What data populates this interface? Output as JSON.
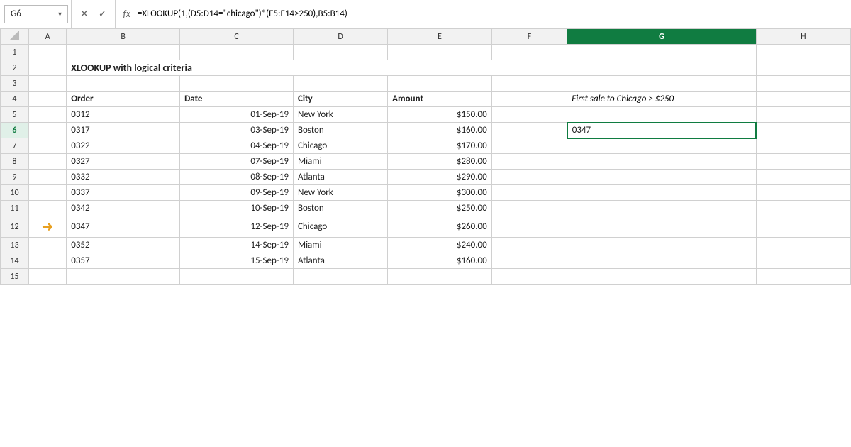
{
  "formulaBar": {
    "cellRef": "G6",
    "dropdownArrow": "▾",
    "icons": {
      "cancel": "✕",
      "confirm": "✓",
      "fx": "fx"
    },
    "formula": "=XLOOKUP(1,(D5:D14=\"chicago\")*(E5:E14>250),B5:B14)"
  },
  "columnHeaders": [
    "",
    "A",
    "B",
    "C",
    "D",
    "E",
    "F",
    "G",
    "H"
  ],
  "title": "XLOOKUP with logical criteria",
  "tableHeaders": {
    "order": "Order",
    "date": "Date",
    "city": "City",
    "amount": "Amount"
  },
  "rows": [
    {
      "rowNum": "1",
      "a": "",
      "b": "",
      "c": "",
      "d": "",
      "e": "",
      "f": "",
      "g": "",
      "h": ""
    },
    {
      "rowNum": "2",
      "a": "",
      "b": "XLOOKUP with logical criteria",
      "c": "",
      "d": "",
      "e": "",
      "f": "",
      "g": "",
      "h": ""
    },
    {
      "rowNum": "3",
      "a": "",
      "b": "",
      "c": "",
      "d": "",
      "e": "",
      "f": "",
      "g": "",
      "h": ""
    },
    {
      "rowNum": "4",
      "a": "",
      "b": "Order",
      "c": "Date",
      "d": "City",
      "e": "Amount",
      "f": "",
      "g": "",
      "h": ""
    },
    {
      "rowNum": "5",
      "a": "",
      "b": "0312",
      "c": "01-Sep-19",
      "d": "New York",
      "e": "$150.00",
      "f": "",
      "g": "",
      "h": ""
    },
    {
      "rowNum": "6",
      "a": "",
      "b": "0317",
      "c": "03-Sep-19",
      "d": "Boston",
      "e": "$160.00",
      "f": "",
      "g": "0347",
      "h": ""
    },
    {
      "rowNum": "7",
      "a": "",
      "b": "0322",
      "c": "04-Sep-19",
      "d": "Chicago",
      "e": "$170.00",
      "f": "",
      "g": "",
      "h": ""
    },
    {
      "rowNum": "8",
      "a": "",
      "b": "0327",
      "c": "07-Sep-19",
      "d": "Miami",
      "e": "$280.00",
      "f": "",
      "g": "",
      "h": ""
    },
    {
      "rowNum": "9",
      "a": "",
      "b": "0332",
      "c": "08-Sep-19",
      "d": "Atlanta",
      "e": "$290.00",
      "f": "",
      "g": "",
      "h": ""
    },
    {
      "rowNum": "10",
      "a": "",
      "b": "0337",
      "c": "09-Sep-19",
      "d": "New York",
      "e": "$300.00",
      "f": "",
      "g": "",
      "h": ""
    },
    {
      "rowNum": "11",
      "a": "",
      "b": "0342",
      "c": "10-Sep-19",
      "d": "Boston",
      "e": "$250.00",
      "f": "",
      "g": "",
      "h": ""
    },
    {
      "rowNum": "12",
      "a": "→",
      "b": "0347",
      "c": "12-Sep-19",
      "d": "Chicago",
      "e": "$260.00",
      "f": "",
      "g": "",
      "h": ""
    },
    {
      "rowNum": "13",
      "a": "",
      "b": "0352",
      "c": "14-Sep-19",
      "d": "Miami",
      "e": "$240.00",
      "f": "",
      "g": "",
      "h": ""
    },
    {
      "rowNum": "14",
      "a": "",
      "b": "0357",
      "c": "15-Sep-19",
      "d": "Atlanta",
      "e": "$160.00",
      "f": "",
      "g": "",
      "h": ""
    },
    {
      "rowNum": "15",
      "a": "",
      "b": "",
      "c": "",
      "d": "",
      "e": "",
      "f": "",
      "g": "",
      "h": ""
    }
  ],
  "label": "First sale to Chicago > $250",
  "resultValue": "0347",
  "colors": {
    "headerActive": "#107c41",
    "arrowColor": "#e8a020",
    "gridBorder": "#d0d0d0"
  }
}
